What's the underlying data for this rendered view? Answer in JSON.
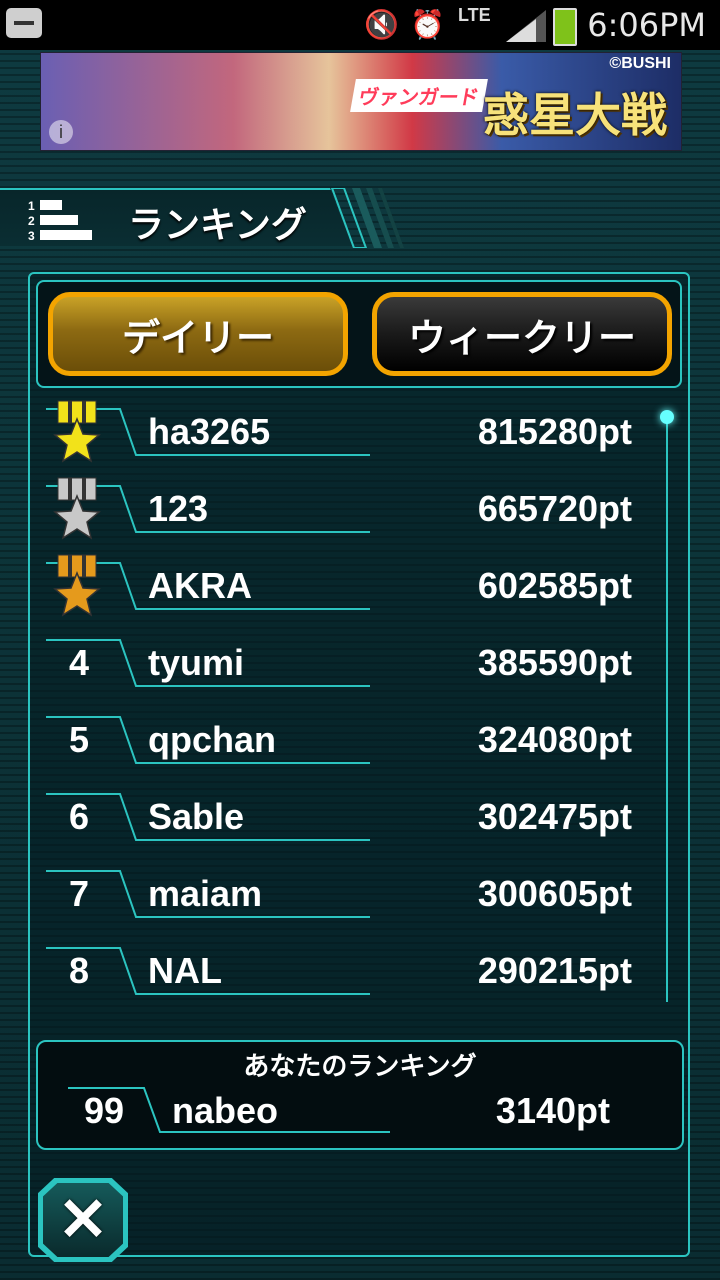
{
  "status_bar": {
    "time": "6:06PM",
    "network": "LTE",
    "icons": [
      "back-icon",
      "mute-icon",
      "alarm-icon",
      "lte-icon",
      "signal-icon",
      "battery-charging-icon"
    ]
  },
  "banner": {
    "title": "惑星大戦",
    "subtitle": "ヴァンガード",
    "copyright": "©BUSHI",
    "info": "i"
  },
  "header": {
    "title": "ランキング",
    "icon": "ranking-icon"
  },
  "tabs": {
    "daily": "デイリー",
    "weekly": "ウィークリー",
    "active": "daily"
  },
  "rankings": [
    {
      "rank": "1",
      "medal": "gold",
      "name": "ha3265",
      "score": "815280pt"
    },
    {
      "rank": "2",
      "medal": "silver",
      "name": "123",
      "score": "665720pt"
    },
    {
      "rank": "3",
      "medal": "bronze",
      "name": "AKRA",
      "score": "602585pt"
    },
    {
      "rank": "4",
      "medal": "",
      "name": "tyumi",
      "score": "385590pt"
    },
    {
      "rank": "5",
      "medal": "",
      "name": "qpchan",
      "score": "324080pt"
    },
    {
      "rank": "6",
      "medal": "",
      "name": "Sable",
      "score": "302475pt"
    },
    {
      "rank": "7",
      "medal": "",
      "name": "maiam",
      "score": "300605pt"
    },
    {
      "rank": "8",
      "medal": "",
      "name": "NAL",
      "score": "290215pt"
    }
  ],
  "my_ranking": {
    "title": "あなたのランキング",
    "rank": "99",
    "name": "nabeo",
    "score": "3140pt"
  },
  "close_label": "✕",
  "colors": {
    "accent": "#2bc4c0",
    "tab_border": "#f3a400",
    "gold": "#f2e21a",
    "silver": "#c8c8c8",
    "bronze": "#e59a1c"
  }
}
